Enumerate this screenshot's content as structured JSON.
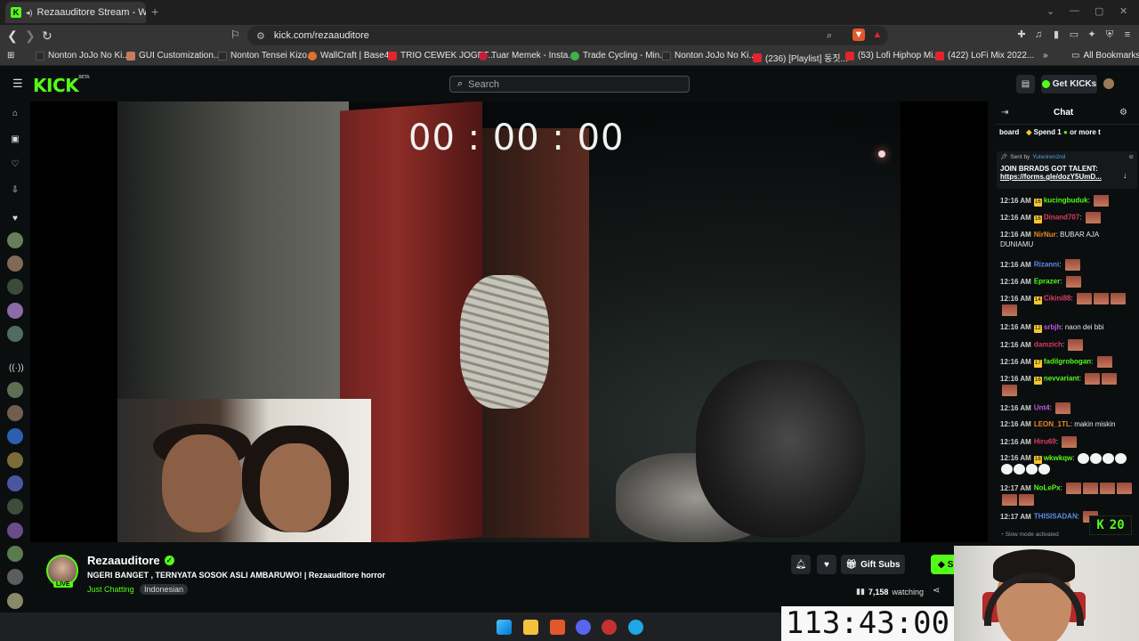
{
  "browser": {
    "tab_title": "Rezaauditore Stream - Watch",
    "url": "kick.com/rezaauditore",
    "bookmarks": [
      {
        "label": "Nonton JoJo No Ki...",
        "color": "#2a2a2a"
      },
      {
        "label": "GUI Customization...",
        "color": "#c87a5a"
      },
      {
        "label": "Nonton Tensei Kizo...",
        "color": "#2a2a2a"
      },
      {
        "label": "WallCraft | Base44",
        "color": "#e2712a"
      },
      {
        "label": "TRIO CEWEK JOGET...",
        "color": "#e0262b"
      },
      {
        "label": "Tuar Memek - Insta...",
        "color": "#c61d3c"
      },
      {
        "label": "Trade Cycling - Min...",
        "color": "#40b24a"
      },
      {
        "label": "Nonton JoJo No Ki...",
        "color": "#2a2a2a"
      },
      {
        "label": "(236) [Playlist] 동짓...",
        "color": "#e0262b"
      },
      {
        "label": "(53) Lofi Hiphop Mi...",
        "color": "#e0262b"
      },
      {
        "label": "(422) LoFi Mix 2022...",
        "color": "#e0262b"
      }
    ],
    "all_bookmarks": "All Bookmarks"
  },
  "kick": {
    "logo": "KICK",
    "logo_beta": "BETA",
    "search_placeholder": "Search",
    "get_kicks": "Get KICKs",
    "accent": "#53fc18"
  },
  "player": {
    "overlay_timer": "00 : 00 : 00"
  },
  "stream": {
    "streamer": "Rezaauditore",
    "live_badge": "LIVE",
    "title": "NGERI BANGET , TERNYATA SOSOK ASLI AMBARUWO! | Rezaauditore horror",
    "category": "Just Chatting",
    "tag": "Indonesian",
    "gift_subs": "Gift Subs",
    "subscribe": "Subsc",
    "watching_count": "7,158",
    "watching_label": "watching"
  },
  "chat": {
    "header": "Chat",
    "leaderboard_label": "board",
    "leaderboard_spend": "Spend 1",
    "leaderboard_more": "or more t",
    "pinned_sent_by": "Sent by",
    "pinned_user": "Yuteriren2nd",
    "pinned_message": "JOIN BRRADS GOT TALENT:",
    "pinned_link": "https://forms.gle/dozY5UmD...",
    "messages": [
      {
        "time": "12:16 AM",
        "badge": "16",
        "user": "kucingbuduk",
        "color": "#53fc18",
        "text": "",
        "emotes": 1
      },
      {
        "time": "12:16 AM",
        "badge": "16",
        "user": "Dinand707",
        "color": "#e03c62",
        "text": "",
        "emotes": 1
      },
      {
        "time": "12:16 AM",
        "badge": "",
        "user": "NirNur",
        "color": "#e8862a",
        "text": "BUBAR AJA DUNIAMU",
        "emotes": 0
      },
      {
        "time": "12:16 AM",
        "badge": "",
        "user": "Rizanni",
        "color": "#5c8de8",
        "text": "",
        "emotes": 1
      },
      {
        "time": "12:16 AM",
        "badge": "",
        "user": "Eprazer",
        "color": "#53fc18",
        "text": "",
        "emotes": 1
      },
      {
        "time": "12:16 AM",
        "badge": "14",
        "user": "Cikini88",
        "color": "#e03c62",
        "text": "",
        "emotes": 4
      },
      {
        "time": "12:16 AM",
        "badge": "12",
        "user": "srbjh",
        "color": "#c255e0",
        "text": "naon dei bbi",
        "emotes": 0
      },
      {
        "time": "12:16 AM",
        "badge": "",
        "user": "damzich",
        "color": "#e03c62",
        "text": "",
        "emotes": 1
      },
      {
        "time": "12:16 AM",
        "badge": "17",
        "user": "fadilgrobogan",
        "color": "#53fc18",
        "text": "",
        "emotes": 1
      },
      {
        "time": "12:16 AM",
        "badge": "16",
        "user": "nevvariant",
        "color": "#53fc18",
        "text": "",
        "emotes": 3
      },
      {
        "time": "12:16 AM",
        "badge": "",
        "user": "Unt4",
        "color": "#c255e0",
        "text": "",
        "emotes": 1
      },
      {
        "time": "12:16 AM",
        "badge": "",
        "user": "LEON_1TL",
        "color": "#e8862a",
        "text": "makin miskin",
        "emotes": 0
      },
      {
        "time": "12:16 AM",
        "badge": "",
        "user": "Hiru69",
        "color": "#e03c62",
        "text": "",
        "emotes": 1
      },
      {
        "time": "12:16 AM",
        "badge": "18",
        "user": "wkwkqw",
        "color": "#53fc18",
        "text": "",
        "emotes": 8
      },
      {
        "time": "12:17 AM",
        "badge": "",
        "user": "NoLePx",
        "color": "#53fc18",
        "text": "",
        "emotes": 6
      },
      {
        "time": "12:17 AM",
        "badge": "",
        "user": "THISISADAN",
        "color": "#5c8de8",
        "text": "",
        "emotes": 1
      }
    ],
    "slow_mode": "Slow mode activated",
    "k_counter": "20"
  },
  "overlays": {
    "big_clock": "113:43:00"
  }
}
